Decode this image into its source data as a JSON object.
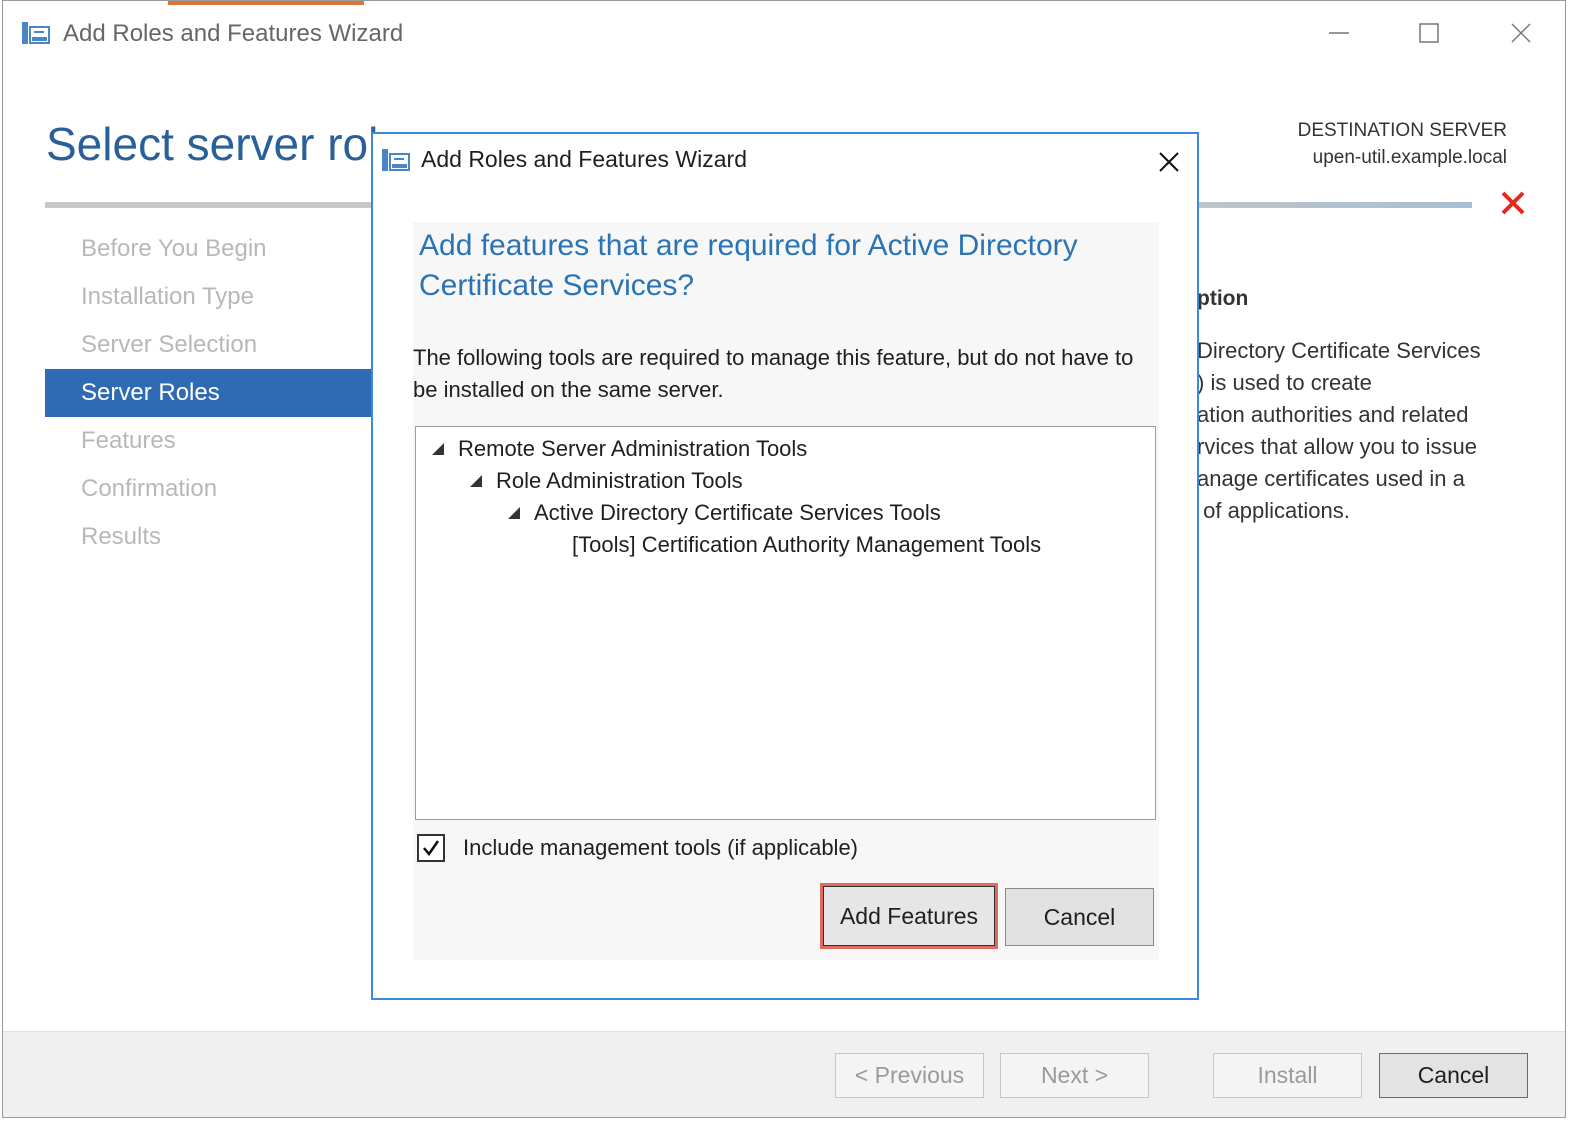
{
  "window": {
    "title": "Add Roles and Features Wizard"
  },
  "page": {
    "title": "Select server roles",
    "destination_label": "DESTINATION SERVER",
    "destination_server": "upen-util.example.local"
  },
  "nav": {
    "items": [
      {
        "label": "Before You Begin"
      },
      {
        "label": "Installation Type"
      },
      {
        "label": "Server Selection"
      },
      {
        "label": "Server Roles",
        "active": true
      },
      {
        "label": "Features"
      },
      {
        "label": "Confirmation"
      },
      {
        "label": "Results"
      }
    ]
  },
  "description": {
    "heading_visible": "ption",
    "lines": "Directory Certificate Services\n) is used to create\nation authorities and related\nrvices that allow you to issue\nanage certificates used in a\n of applications."
  },
  "footer": {
    "previous": "< Previous",
    "next": "Next >",
    "install": "Install",
    "cancel": "Cancel"
  },
  "dialog": {
    "title": "Add Roles and Features Wizard",
    "heading": "Add features that are required for Active Directory Certificate Services?",
    "text": "The following tools are required to manage this feature, but do not have to be installed on the same server.",
    "tree": [
      {
        "label": "Remote Server Administration Tools",
        "level": 0,
        "expanded": true
      },
      {
        "label": "Role Administration Tools",
        "level": 1,
        "expanded": true
      },
      {
        "label": "Active Directory Certificate Services Tools",
        "level": 2,
        "expanded": true
      },
      {
        "label": "[Tools] Certification Authority Management Tools",
        "level": 3,
        "expanded": false
      }
    ],
    "include_tools_label": "Include management tools (if applicable)",
    "include_tools_checked": true,
    "add_button": "Add Features",
    "cancel_button": "Cancel"
  },
  "colors": {
    "accent": "#2f6bb4",
    "heading_blue": "#2a74b5",
    "highlight_red": "#e06a5f",
    "error_red": "#e8271d"
  }
}
